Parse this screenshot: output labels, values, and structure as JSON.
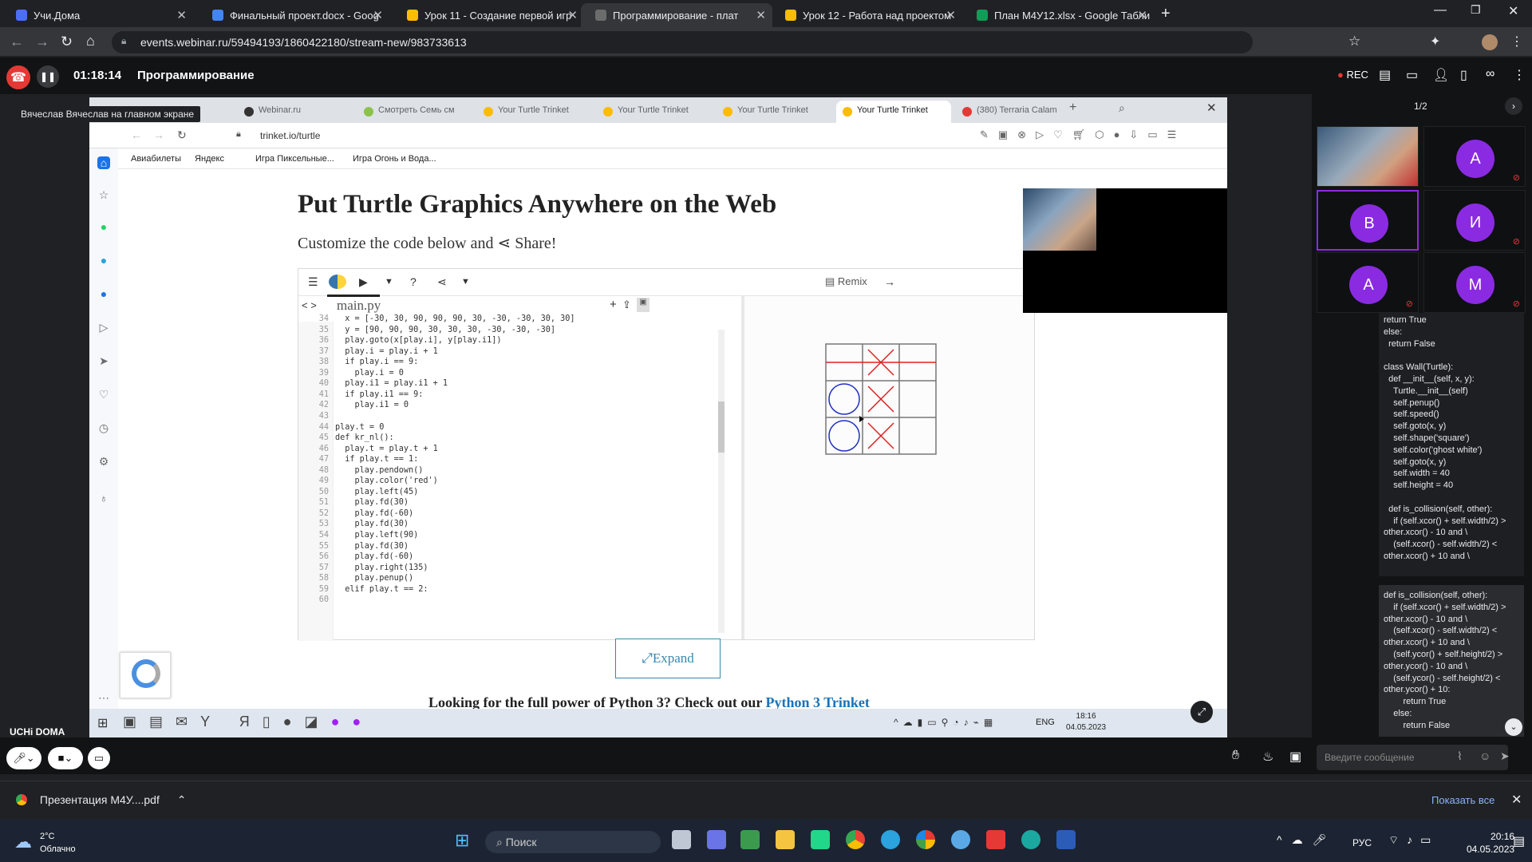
{
  "outer_tabs": [
    {
      "label": "Учи.Дома",
      "color": "#4c6ef5"
    },
    {
      "label": "Финальный проект.docx - Goog",
      "color": "#4285f4"
    },
    {
      "label": "Урок 11 - Создание первой игр",
      "color": "#fbbc04"
    },
    {
      "label": "Программирование - плат",
      "color": "#6c6c6c"
    },
    {
      "label": "Урок 12 - Работа над проектом",
      "color": "#fbbc04"
    },
    {
      "label": "План М4У12.xlsx - Google Табли",
      "color": "#0f9d58"
    }
  ],
  "outer_url": "events.webinar.ru/59494193/1860422180/stream-new/983733613",
  "webinar": {
    "timer": "01:18:14",
    "title": "Программирование",
    "rec": "REC",
    "speaker_label": "Вячеслав Вячеслав на главном экране",
    "page_count": "1/2"
  },
  "inner_tabs": [
    "Webinar.ru",
    "Смотреть Семь см",
    "Your Turtle Trinket",
    "Your Turtle Trinket",
    "Your Turtle Trinket",
    "Your Turtle Trinket",
    "(380) Terraria Calam"
  ],
  "inner_url": "trinket.io/turtle",
  "bookmarks": [
    "Авиабилеты",
    "Яндекс",
    "Игра Пиксельные...",
    "Игра Огонь и Вода..."
  ],
  "page": {
    "title": "Put Turtle Graphics Anywhere on the Web",
    "subtitle": "Customize the code below and",
    "share_word": "Share!",
    "remix": "Remix",
    "file": "main.py",
    "expand": "Expand",
    "footnote_a": "Looking for the full power of Python 3? Check out our",
    "footnote_link": "Python 3 Trinket"
  },
  "code_lines": [
    {
      "n": "34",
      "t": "  x = [-30, 30, 90, 90, 90, 30, -30, -30, 30, 30]"
    },
    {
      "n": "35",
      "t": "  y = [90, 90, 90, 30, 30, 30, -30, -30, -30]"
    },
    {
      "n": "36",
      "t": "  play.goto(x[play.i], y[play.i1])"
    },
    {
      "n": "37",
      "t": "  play.i = play.i + 1"
    },
    {
      "n": "38",
      "t": "  if play.i == 9:"
    },
    {
      "n": "39",
      "t": "    play.i = 0"
    },
    {
      "n": "40",
      "t": "  play.i1 = play.i1 + 1"
    },
    {
      "n": "41",
      "t": "  if play.i1 == 9:"
    },
    {
      "n": "42",
      "t": "    play.i1 = 0"
    },
    {
      "n": "43",
      "t": ""
    },
    {
      "n": "44",
      "t": "play.t = 0"
    },
    {
      "n": "45",
      "t": "def kr_nl():"
    },
    {
      "n": "46",
      "t": "  play.t = play.t + 1"
    },
    {
      "n": "47",
      "t": "  if play.t == 1:"
    },
    {
      "n": "48",
      "t": "    play.pendown()"
    },
    {
      "n": "49",
      "t": "    play.color('red')"
    },
    {
      "n": "50",
      "t": "    play.left(45)"
    },
    {
      "n": "51",
      "t": "    play.fd(30)"
    },
    {
      "n": "52",
      "t": "    play.fd(-60)"
    },
    {
      "n": "53",
      "t": "    play.fd(30)"
    },
    {
      "n": "54",
      "t": "    play.left(90)"
    },
    {
      "n": "55",
      "t": "    play.fd(30)"
    },
    {
      "n": "56",
      "t": "    play.fd(-60)"
    },
    {
      "n": "57",
      "t": "    play.right(135)"
    },
    {
      "n": "58",
      "t": "    play.penup()"
    },
    {
      "n": "59",
      "t": "  elif play.t == 2:"
    },
    {
      "n": "60",
      "t": ""
    }
  ],
  "inner_taskbar": {
    "time": "18:16",
    "date": "04.05.2023",
    "lang": "ENG"
  },
  "participants": [
    "В",
    "И",
    "А",
    "М"
  ],
  "participant_top": "А",
  "chat1": [
    "return True",
    "else:",
    "  return False",
    "",
    "class Wall(Turtle):",
    "  def __init__(self, x, y):",
    "    Turtle.__init__(self)",
    "    self.penup()",
    "    self.speed()",
    "    self.goto(x, y)",
    "    self.shape('square')",
    "    self.color('ghost white')",
    "    self.goto(x, y)",
    "    self.width = 40",
    "    self.height = 40",
    "",
    "  def is_collision(self, other):",
    "    if (self.xcor() + self.width/2) >",
    "other.xcor() - 10 and \\",
    "    (self.xcor() - self.width/2) <",
    "other.xcor() + 10 and \\"
  ],
  "chat2": [
    "def is_collision(self, other):",
    "    if (self.xcor() + self.width/2) >",
    "other.xcor() - 10 and \\",
    "    (self.xcor() - self.width/2) <",
    "other.xcor() + 10 and \\",
    "    (self.ycor() + self.height/2) >",
    "other.ycor() - 10 and \\",
    "    (self.ycor() - self.height/2) <",
    "other.ycor() + 10:",
    "        return True",
    "    else:",
    "        return False"
  ],
  "message_placeholder": "Введите сообщение",
  "download": {
    "file": "Презентация М4У....pdf",
    "show_all": "Показать все"
  },
  "uchi_logo": "UCHi DOMA",
  "weather": {
    "temp": "2°C",
    "desc": "Облачно"
  },
  "search": "Поиск",
  "os": {
    "lang": "РУС",
    "time": "20:16",
    "date": "04.05.2023"
  }
}
